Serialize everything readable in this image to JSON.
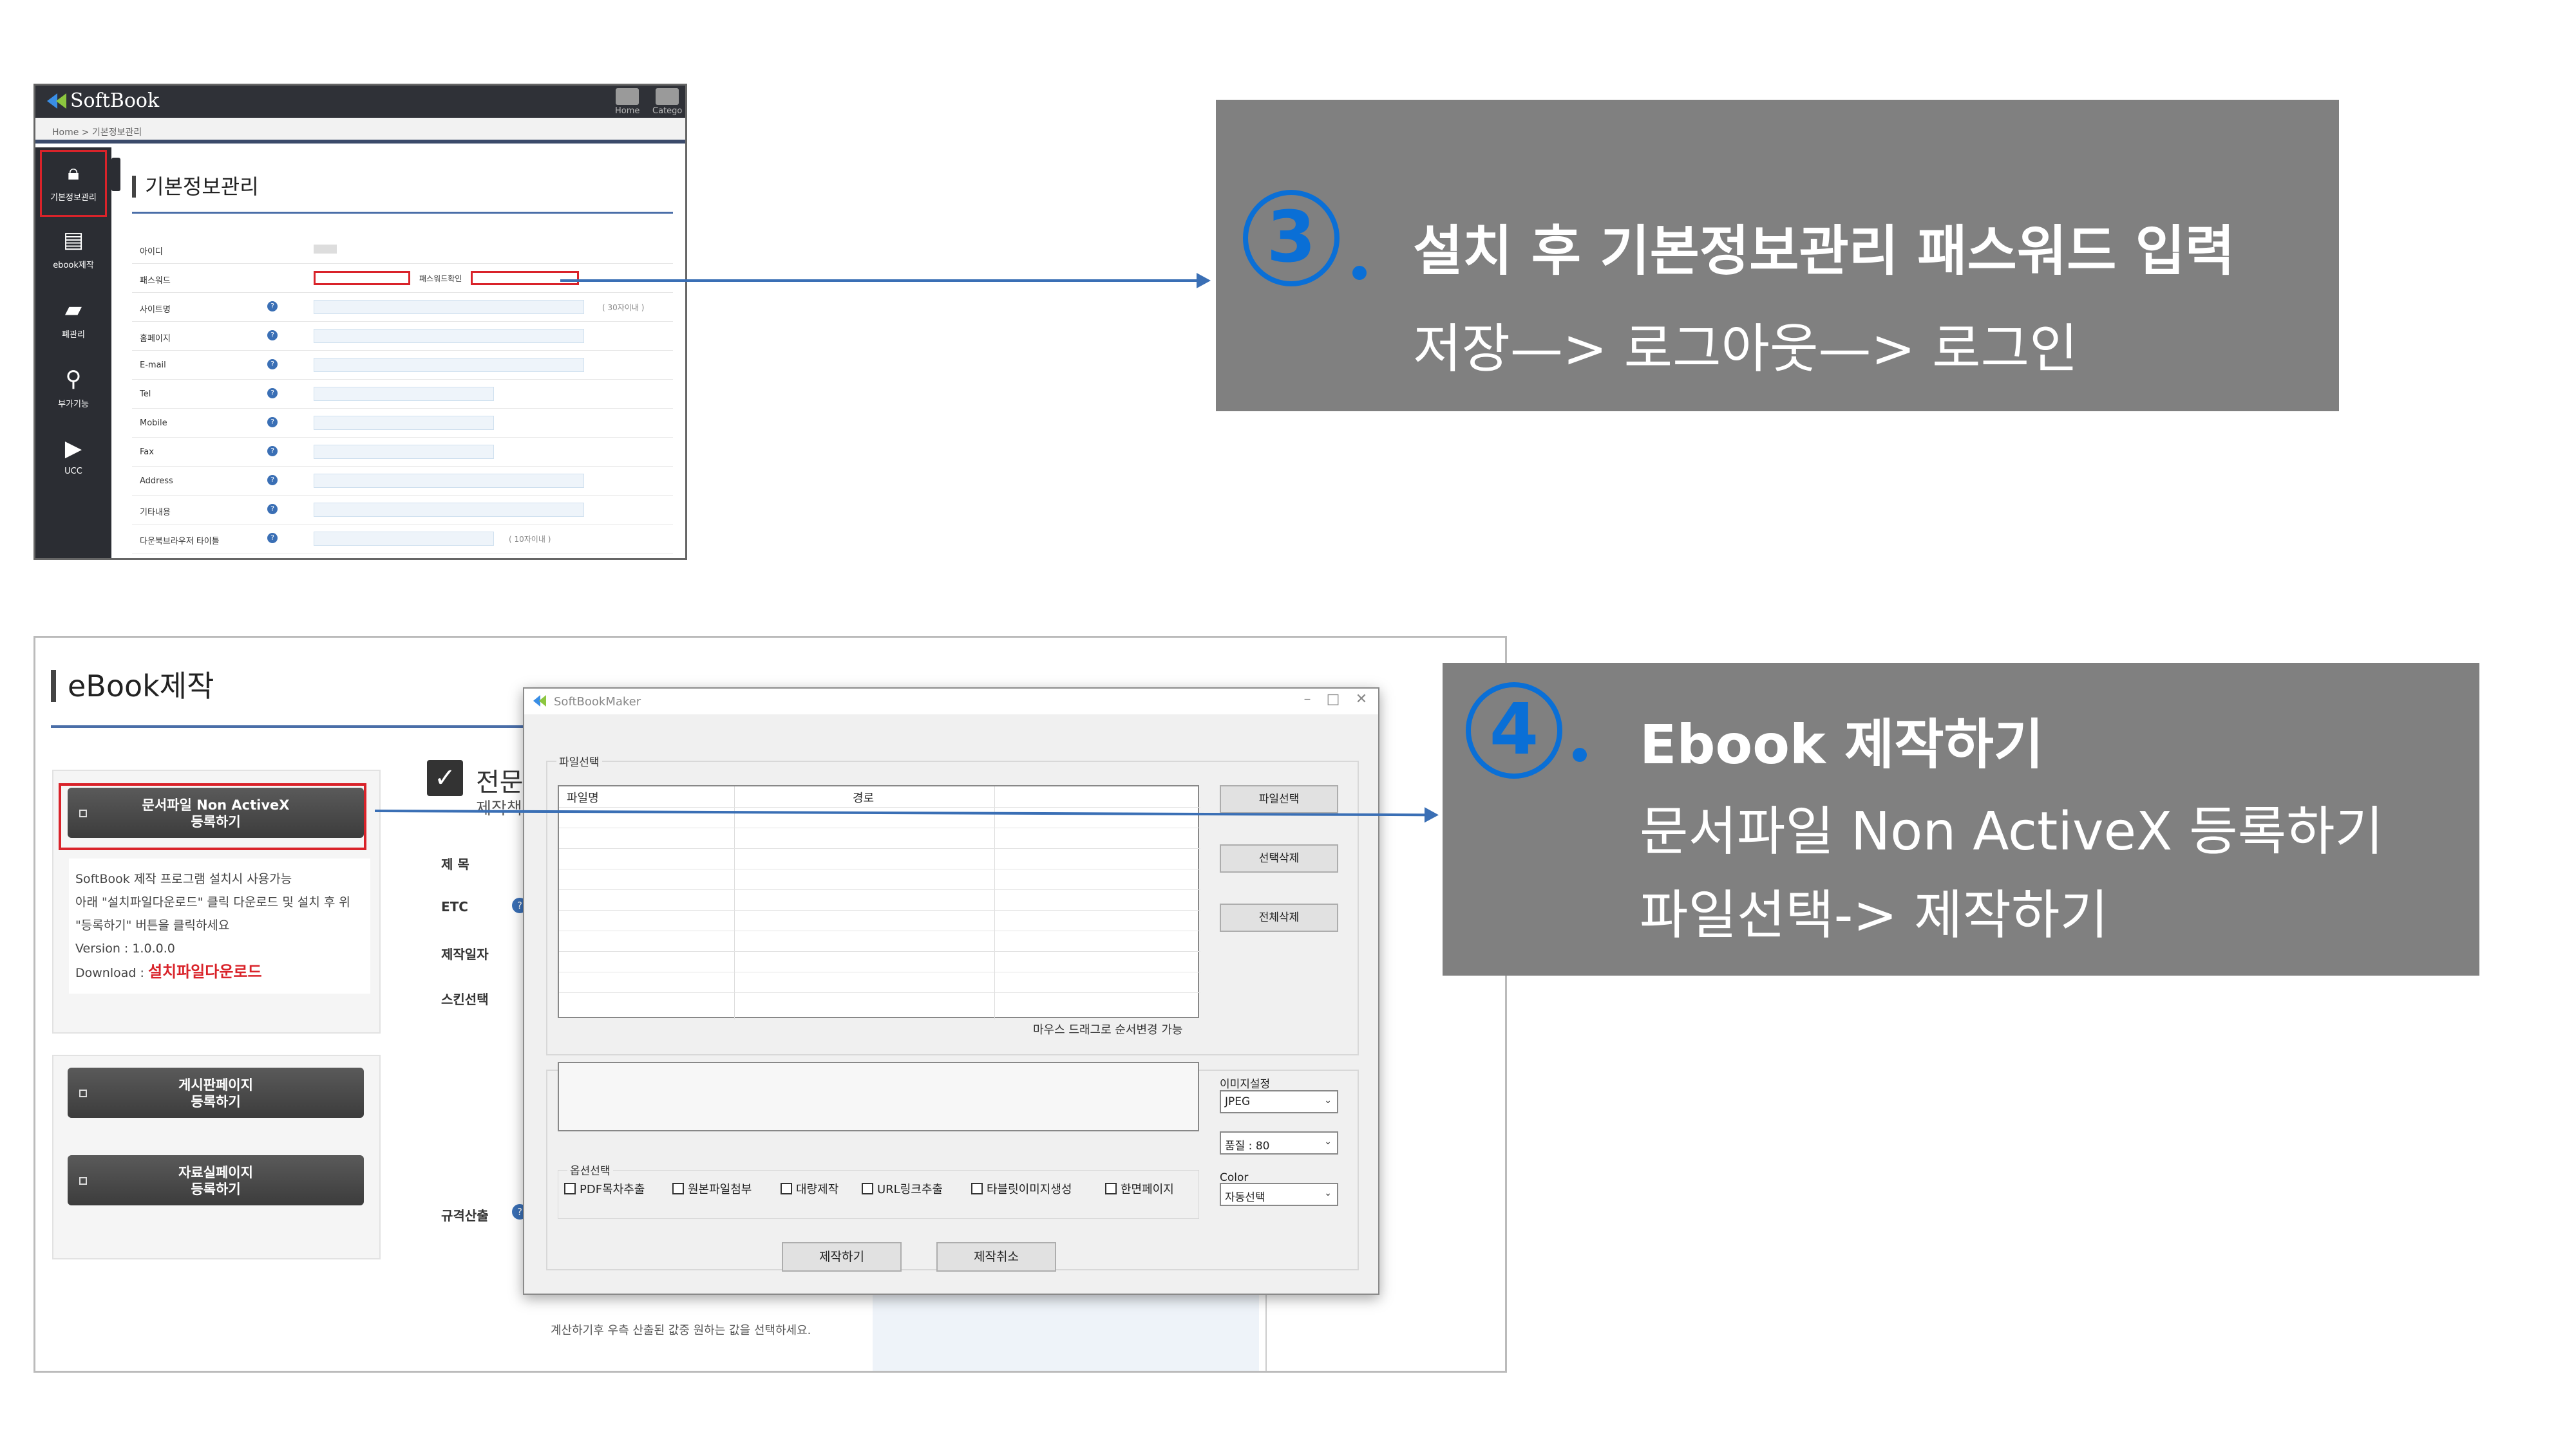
{
  "softbook": {
    "logo": "SoftBook",
    "nav": {
      "home": "Home",
      "category": "Catego"
    },
    "breadcrumb": "Home > 기본정보관리",
    "sidebar": [
      {
        "label": "기본정보관리",
        "icon": "lock-icon"
      },
      {
        "label": "ebook제작",
        "icon": "document-icon"
      },
      {
        "label": "폐관리",
        "icon": "folder-icon"
      },
      {
        "label": "부가기능",
        "icon": "map-pin-icon"
      },
      {
        "label": "UCC",
        "icon": "play-icon"
      }
    ],
    "page_title": "기본정보관리",
    "fields": [
      {
        "label": "아이디",
        "value": "",
        "help": false
      },
      {
        "label": "패스워드",
        "confirm_label": "패스워드확인",
        "help": false
      },
      {
        "label": "사이트명",
        "note": "( 30자이내 )",
        "help": true
      },
      {
        "label": "홈페이지",
        "help": true
      },
      {
        "label": "E-mail",
        "help": true
      },
      {
        "label": "Tel",
        "help": true
      },
      {
        "label": "Mobile",
        "help": true
      },
      {
        "label": "Fax",
        "help": true
      },
      {
        "label": "Address",
        "help": true
      },
      {
        "label": "기타내용",
        "help": true
      },
      {
        "label": "다운북브라우저 타이틀",
        "note": "( 10자이내 )",
        "help": true
      }
    ]
  },
  "ebook": {
    "page_title": "eBook제작",
    "register_button": {
      "line1": "문서파일 Non ActiveX",
      "line2": "등록하기"
    },
    "info_lines": [
      "SoftBook 제작 프로그램 설치시 사용가능",
      "아래 \"설치파일다운로드\" 클릭 다운로드 및 설치 후 위",
      "\"등록하기\" 버튼을 클릭하세요",
      "Version : 1.0.0.0"
    ],
    "download_label": "Download : ",
    "download_link": "설치파일다운로드",
    "board_button": {
      "line1": "게시판페이지",
      "line2": "등록하기"
    },
    "data_button": {
      "line1": "자료실페이지",
      "line2": "등록하기"
    },
    "section_title": "전문가",
    "section_sub": "제작책",
    "form_labels": [
      "제 목",
      "ETC",
      "제작일자",
      "스킨선택",
      "규격산출"
    ],
    "bottom_note": "계산하기후 우측 산출된 값중 원하는 값을 선택하세요."
  },
  "maker": {
    "window_title": "SoftBookMaker",
    "group_file": "파일선택",
    "columns": [
      "파일명",
      "경로"
    ],
    "buttons": [
      "파일선택",
      "선택삭제",
      "전체삭제"
    ],
    "drag_note": "마우스 드래그로 순서변경 가능",
    "group_options": "옵션선택",
    "options": [
      "PDF목차추출",
      "원본파일첨부",
      "대량제작",
      "URL링크추출",
      "타블릿이미지생성",
      "한면페이지"
    ],
    "image_setting_label": "이미지설정",
    "format": "JPEG",
    "quality": "품질 : 80",
    "color_label": "Color",
    "color_value": "자동선택",
    "make_button": "제작하기",
    "cancel_button": "제작취소"
  },
  "callout3": {
    "number": "3",
    "title": "설치 후 기본정보관리 패스워드 입력",
    "line": "저장—> 로그아웃—> 로그인"
  },
  "callout4": {
    "number": "4",
    "title": "Ebook 제작하기",
    "line1": "문서파일 Non ActiveX 등록하기",
    "line2": "파일선택-> 제작하기"
  },
  "colors": {
    "accent": "#0a6fd6",
    "callout_bg": "#808080",
    "highlight": "#d9232a",
    "sidebar": "#2b2d33"
  }
}
